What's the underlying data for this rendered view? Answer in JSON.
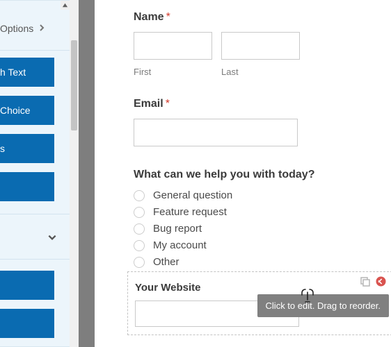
{
  "sidebar": {
    "options_label": "Options",
    "buttons": {
      "b1": "h Text",
      "b2": "Choice",
      "b3": "s",
      "b4": "",
      "b5": ""
    }
  },
  "form": {
    "name": {
      "label": "Name",
      "first_sub": "First",
      "last_sub": "Last"
    },
    "email": {
      "label": "Email"
    },
    "help": {
      "label": "What can we help you with today?",
      "options": {
        "o1": "General question",
        "o2": "Feature request",
        "o3": "Bug report",
        "o4": "My account",
        "o5": "Other"
      }
    },
    "website": {
      "label": "Your Website"
    }
  },
  "tooltip": "Click to edit. Drag to reorder."
}
